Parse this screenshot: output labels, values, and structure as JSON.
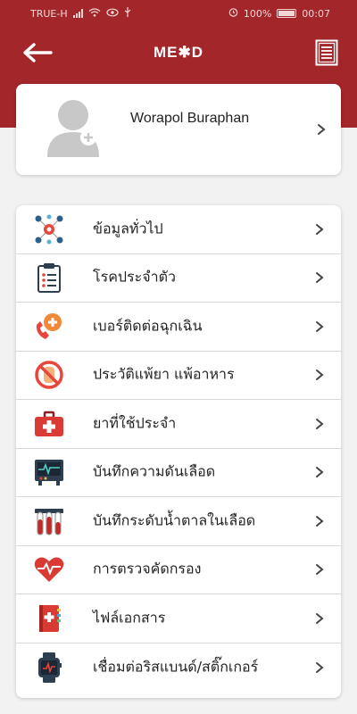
{
  "status_bar": {
    "carrier": "TRUE-H",
    "battery_percent": "100%",
    "time": "00:07"
  },
  "header": {
    "back_icon": "arrow-left-icon",
    "logo_text": "ME✱D",
    "document_icon": "document-list-icon"
  },
  "profile": {
    "name": "Worapol Buraphan",
    "avatar_icon": "user-add-avatar-icon"
  },
  "menu": {
    "items": [
      {
        "label": "ข้อมูลทั่วไป",
        "icon": "general-info-icon"
      },
      {
        "label": "โรคประจำตัว",
        "icon": "clipboard-icon"
      },
      {
        "label": "เบอร์ติดต่อฉุกเฉิน",
        "icon": "emergency-phone-icon"
      },
      {
        "label": "ประวัติแพ้ยา แพ้อาหาร",
        "icon": "allergy-icon"
      },
      {
        "label": "ยาที่ใช้ประจำ",
        "icon": "medicine-kit-icon"
      },
      {
        "label": "บันทึกความดันเลือด",
        "icon": "blood-pressure-monitor-icon"
      },
      {
        "label": "บันทึกระดับน้ำตาลในเลือด",
        "icon": "blood-tubes-icon"
      },
      {
        "label": "การตรวจคัดกรอง",
        "icon": "heartbeat-icon"
      },
      {
        "label": "ไฟล์เอกสาร",
        "icon": "document-book-icon"
      },
      {
        "label": "เชื่อมต่อริสแบนด์/สติ๊กเกอร์",
        "icon": "smartwatch-icon"
      }
    ]
  },
  "colors": {
    "header_red": "#a3262b",
    "background": "#f2f2f2",
    "card": "#ffffff"
  }
}
